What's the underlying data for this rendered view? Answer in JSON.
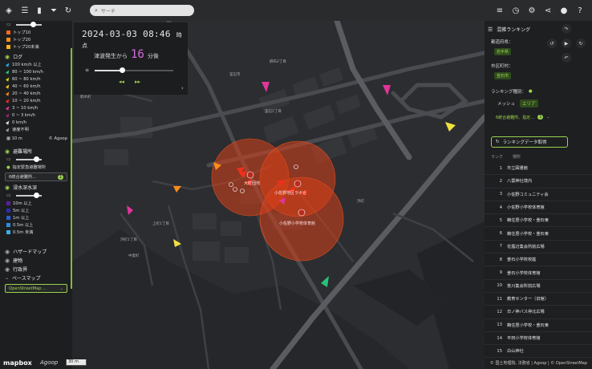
{
  "topbar": {
    "icons": [
      "layers-icon",
      "list-icon",
      "bar-chart-icon",
      "filter-icon",
      "refresh-icon"
    ],
    "search_placeholder": "サーチ",
    "right_icons": [
      "filter-list-icon",
      "clock-speed-icon",
      "gear-icon",
      "share-icon",
      "user-icon",
      "help-icon"
    ]
  },
  "left": {
    "top_items": [
      {
        "color": "#ff6a1a",
        "label": "トップ10"
      },
      {
        "color": "#ff8c1a",
        "label": "トップ20"
      },
      {
        "color": "#ffb21a",
        "label": "トップ20未満"
      }
    ],
    "log": {
      "title": "ログ",
      "items": [
        {
          "color": "#28a9e1",
          "label": "100 km/h 以上"
        },
        {
          "color": "#27c27a",
          "label": "80 ~ 100 km/h"
        },
        {
          "color": "#c6d419",
          "label": "60 ~ 80 km/h"
        },
        {
          "color": "#f0c419",
          "label": "40 ~ 60 km/h"
        },
        {
          "color": "#f08a19",
          "label": "20 ~ 40 km/h"
        },
        {
          "color": "#f0301d",
          "label": "10 ~ 20 km/h"
        },
        {
          "color": "#e0359a",
          "label": "3 ~ 10 km/h"
        },
        {
          "color": "#a02070",
          "label": "0 ~ 3 km/h"
        },
        {
          "color": "#dddddd",
          "label": "0 km/h"
        },
        {
          "color": "#999999",
          "label": "速度不明"
        }
      ],
      "distance": "10 m",
      "credit": "© Agoop"
    },
    "shelter": {
      "title": "避難場所",
      "sub_label": "指定緊急避難場所",
      "dropdown": "6統合避難所…",
      "badge": "1"
    },
    "flood": {
      "title": "浸水深水深",
      "items": [
        {
          "color": "#5a1fa0",
          "label": "10m 以上"
        },
        {
          "color": "#2a2fb0",
          "label": "5m 以上"
        },
        {
          "color": "#2a5fd0",
          "label": "1m 以上"
        },
        {
          "color": "#2a8fe0",
          "label": "0.5m 以上"
        },
        {
          "color": "#3ab0e8",
          "label": "0.5m 未満"
        }
      ]
    },
    "layers": [
      "ハザードマップ",
      "建物",
      "行政界"
    ],
    "basemap": {
      "title": "ベースマップ",
      "value": "OpenStreetMap ..."
    }
  },
  "time": {
    "datetime": "2024-03-03 08:46",
    "unit": "時点",
    "elapsed_prefix": "津波発生から",
    "elapsed_value": "16",
    "elapsed_suffix": "分後",
    "slider_position": 0.35
  },
  "right": {
    "title": "混雑ランキング",
    "region_label": "都道府県：",
    "region_value": "岩手県",
    "city_label": "市区町村：",
    "city_value": "釜石市",
    "type_label": "ランキング種別：",
    "tab_mesh": "メッシュ",
    "tab_area": "エリア",
    "area_select": "6統合避難所、指定…",
    "area_badge": "1",
    "fetch_button": "ランキングデータ取得",
    "col_rank": "ランク",
    "col_name": "場所",
    "rows": [
      {
        "rank": "1",
        "name": "市立図書館"
      },
      {
        "rank": "2",
        "name": "八雲神社境内"
      },
      {
        "rank": "3",
        "name": "小佐野コミュニティ会"
      },
      {
        "rank": "4",
        "name": "小佐野小学校体育館"
      },
      {
        "rank": "5",
        "name": "鵜住居小学校・釜石東"
      },
      {
        "rank": "6",
        "name": "鵜住居小学校・釜石東"
      },
      {
        "rank": "7",
        "name": "花露辺集会所前広場"
      },
      {
        "rank": "8",
        "name": "釜石小学校校庭"
      },
      {
        "rank": "9",
        "name": "釜石小学校体育館"
      },
      {
        "rank": "10",
        "name": "荒川集会所前広場"
      },
      {
        "rank": "11",
        "name": "教育センター（旧館）"
      },
      {
        "rank": "12",
        "name": "日ノ神バス停北広場"
      },
      {
        "rank": "13",
        "name": "鵜住居小学校・釜石東"
      },
      {
        "rank": "14",
        "name": "平田小学校体育館"
      },
      {
        "rank": "15",
        "name": "白山神社"
      }
    ]
  },
  "map": {
    "hot_labels": [
      "大町団地",
      "小佐野地区ラボ合",
      "小佐野小学校体育館"
    ],
    "labels": [
      "麻布2丁目",
      "釜石市",
      "浜町",
      "浜町1丁目",
      "上町1丁目",
      "釜石1丁目",
      "中妻町",
      "駒木町"
    ]
  },
  "bottom": {
    "mapbox": "mapbox",
    "agoop": "Agoop",
    "scale": "30 m",
    "attribution": "© 国土地理院, 法務省 | Agoop | © OpenStreetMap"
  }
}
